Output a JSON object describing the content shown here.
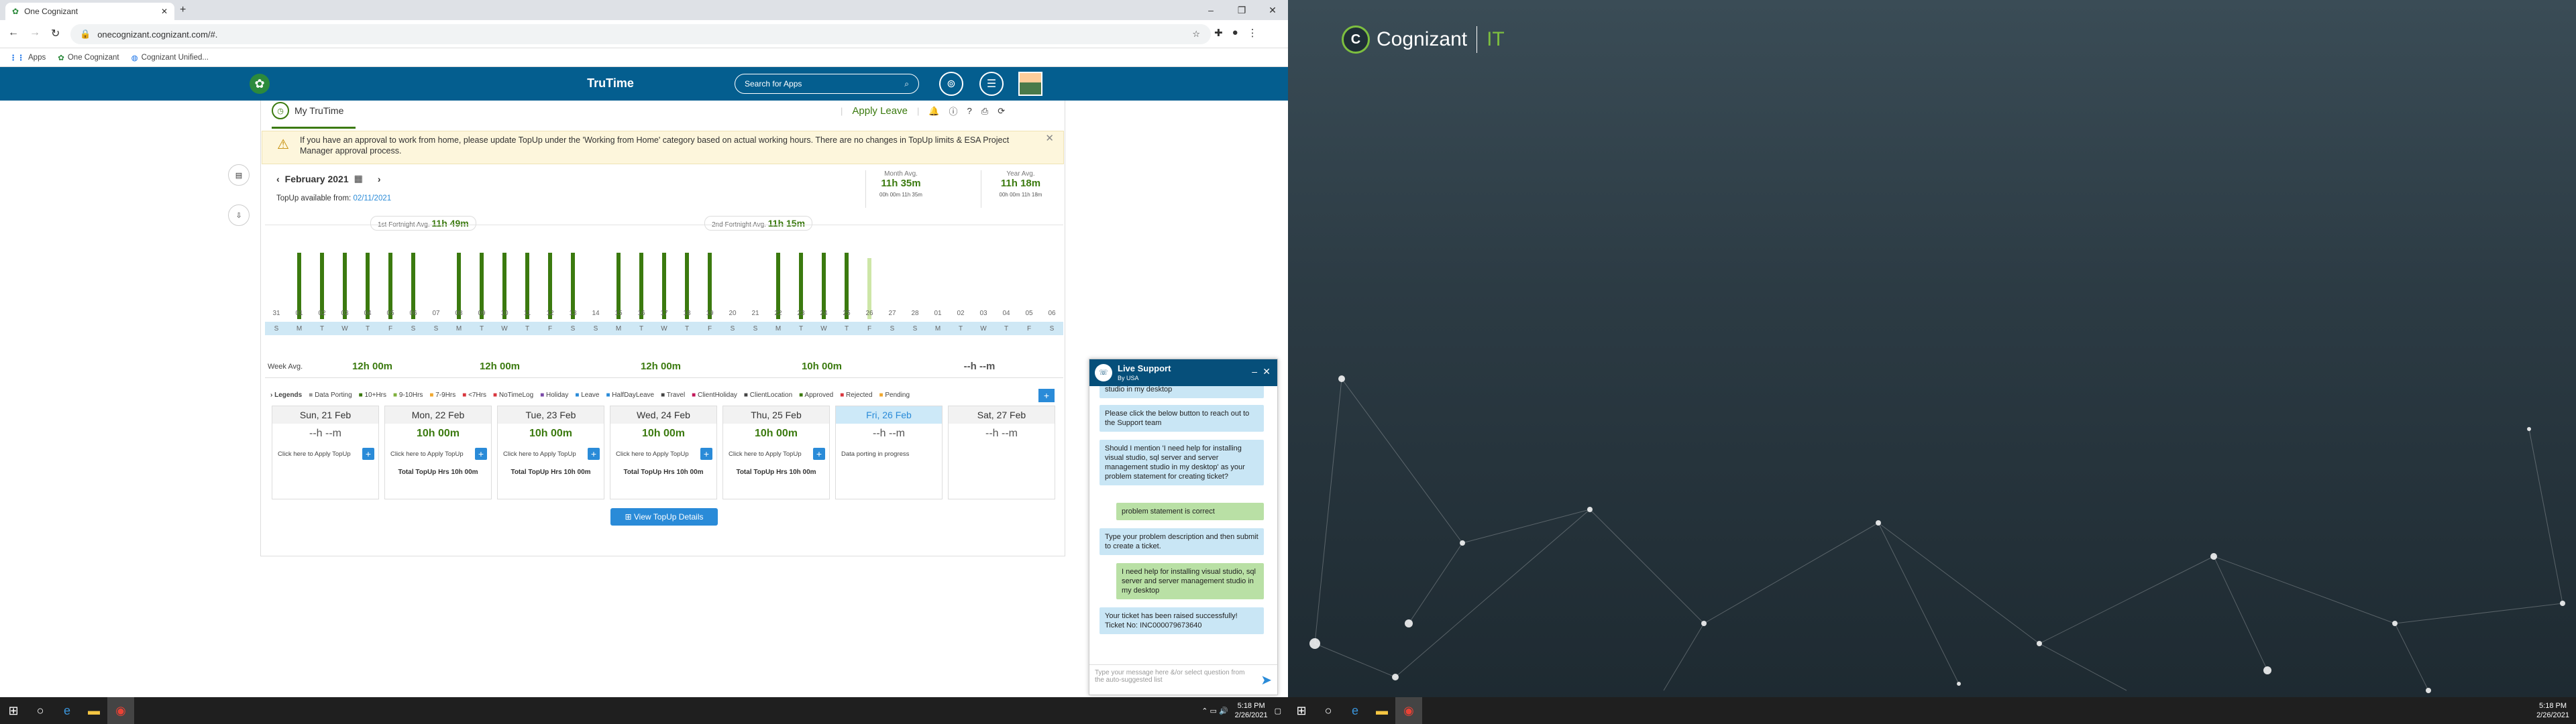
{
  "browser": {
    "tab_title": "One Cognizant",
    "url": "onecognizant.cognizant.com/#.",
    "bookmarks": [
      "Apps",
      "One Cognizant",
      "Cognizant Unified..."
    ]
  },
  "app": {
    "title": "TruTime",
    "search_placeholder": "Search for Apps"
  },
  "header": {
    "my_trutime": "My TruTime",
    "apply_leave": "Apply Leave"
  },
  "alert": {
    "text": "If you have an approval to work from home, please update TopUp under the 'Working from Home' category based on actual working hours. There are no changes in TopUp limits & ESA Project Manager approval process."
  },
  "period": {
    "month": "February 2021",
    "topup_label": "TopUp available from:",
    "topup_date": "02/11/2021",
    "month_avg_label": "Month Avg.",
    "month_avg": "11h 35m",
    "year_avg_label": "Year Avg.",
    "year_avg": "11h 18m",
    "mini_a": "00h 00m",
    "mini_b": "11h 35m",
    "mini_c": "00h 00m",
    "mini_d": "11h 18m"
  },
  "fortnight": {
    "first_label": "1st Fortnight Avg.",
    "first_value": "11h 49m",
    "second_label": "2nd Fortnight Avg.",
    "second_value": "11h 15m"
  },
  "days": [
    "31",
    "01",
    "02",
    "03",
    "04",
    "05",
    "06",
    "07",
    "08",
    "09",
    "10",
    "11",
    "12",
    "13",
    "14",
    "15",
    "16",
    "17",
    "18",
    "19",
    "20",
    "21",
    "22",
    "23",
    "24",
    "25",
    "26",
    "27",
    "28",
    "01",
    "02",
    "03",
    "04",
    "05",
    "06"
  ],
  "weekdays": [
    "S",
    "M",
    "T",
    "W",
    "T",
    "F",
    "S",
    "S",
    "M",
    "T",
    "W",
    "T",
    "F",
    "S",
    "S",
    "M",
    "T",
    "W",
    "T",
    "F",
    "S",
    "S",
    "M",
    "T",
    "W",
    "T",
    "F",
    "S",
    "S",
    "M",
    "T",
    "W",
    "T",
    "F",
    "S"
  ],
  "bars": [
    0,
    0.6,
    0.6,
    0.6,
    0.6,
    0.6,
    0.6,
    0,
    0.6,
    0.6,
    0.6,
    0.6,
    0.6,
    0.6,
    0,
    0.6,
    0.6,
    0.6,
    0.6,
    0.6,
    0,
    0,
    0.6,
    0.6,
    0.6,
    0.6,
    0.55,
    0,
    0,
    0,
    0,
    0,
    0,
    0,
    0
  ],
  "week_avg": {
    "label": "Week Avg.",
    "values": [
      "12h 00m",
      "12h 00m",
      "12h 00m",
      "10h 00m",
      "--h --m"
    ]
  },
  "legends": {
    "title": "Legends",
    "items": [
      "Data Porting",
      "10+Hrs",
      "9-10Hrs",
      "7-9Hrs",
      "<7Hrs",
      "NoTimeLog",
      "Holiday",
      "Leave",
      "HalfDayLeave",
      "Travel",
      "ClientHoliday",
      "ClientLocation",
      "Approved",
      "Rejected",
      "Pending"
    ]
  },
  "cards": [
    {
      "date": "Sun, 21 Feb",
      "hours": "--h --m",
      "apply": "Click here to Apply TopUp",
      "total": ""
    },
    {
      "date": "Mon, 22 Feb",
      "hours": "10h 00m",
      "apply": "Click here to Apply TopUp",
      "total": "Total TopUp Hrs 10h 00m"
    },
    {
      "date": "Tue, 23 Feb",
      "hours": "10h 00m",
      "apply": "Click here to Apply TopUp",
      "total": "Total TopUp Hrs 10h 00m"
    },
    {
      "date": "Wed, 24 Feb",
      "hours": "10h 00m",
      "apply": "Click here to Apply TopUp",
      "total": "Total TopUp Hrs 10h 00m"
    },
    {
      "date": "Thu, 25 Feb",
      "hours": "10h 00m",
      "apply": "Click here to Apply TopUp",
      "total": "Total TopUp Hrs 10h 00m"
    },
    {
      "date": "Fri, 26 Feb",
      "hours": "--h --m",
      "apply": "Data porting in progress",
      "total": ""
    },
    {
      "date": "Sat, 27 Feb",
      "hours": "--h --m",
      "apply": "",
      "total": ""
    }
  ],
  "view_details": "View TopUp Details",
  "chat": {
    "title": "Live Support",
    "subtitle": "By USA",
    "msgs": [
      {
        "who": "bot",
        "text": "studio in my desktop"
      },
      {
        "who": "bot",
        "text": "Please click the below button to reach out to the Support team"
      },
      {
        "who": "bot",
        "text": "Should I mention 'I need help for installing visual studio, sql server and server management studio in my desktop' as your problem statement for creating ticket?"
      },
      {
        "who": "usr",
        "text": "problem statement is correct"
      },
      {
        "who": "bot",
        "text": "Type your problem description and then submit to create a ticket."
      },
      {
        "who": "usr",
        "text": "I need help for installing visual studio, sql server and server management studio in my desktop"
      },
      {
        "who": "bot",
        "text": "Your ticket has been raised successfully! Ticket No: INC000079673640"
      }
    ],
    "input_placeholder": "Type your message here &/or select question from the auto-suggested list"
  },
  "taskbar": {
    "time": "5:18 PM",
    "date": "2/26/2021"
  },
  "brand": {
    "name": "Cognizant",
    "suffix": "IT"
  }
}
